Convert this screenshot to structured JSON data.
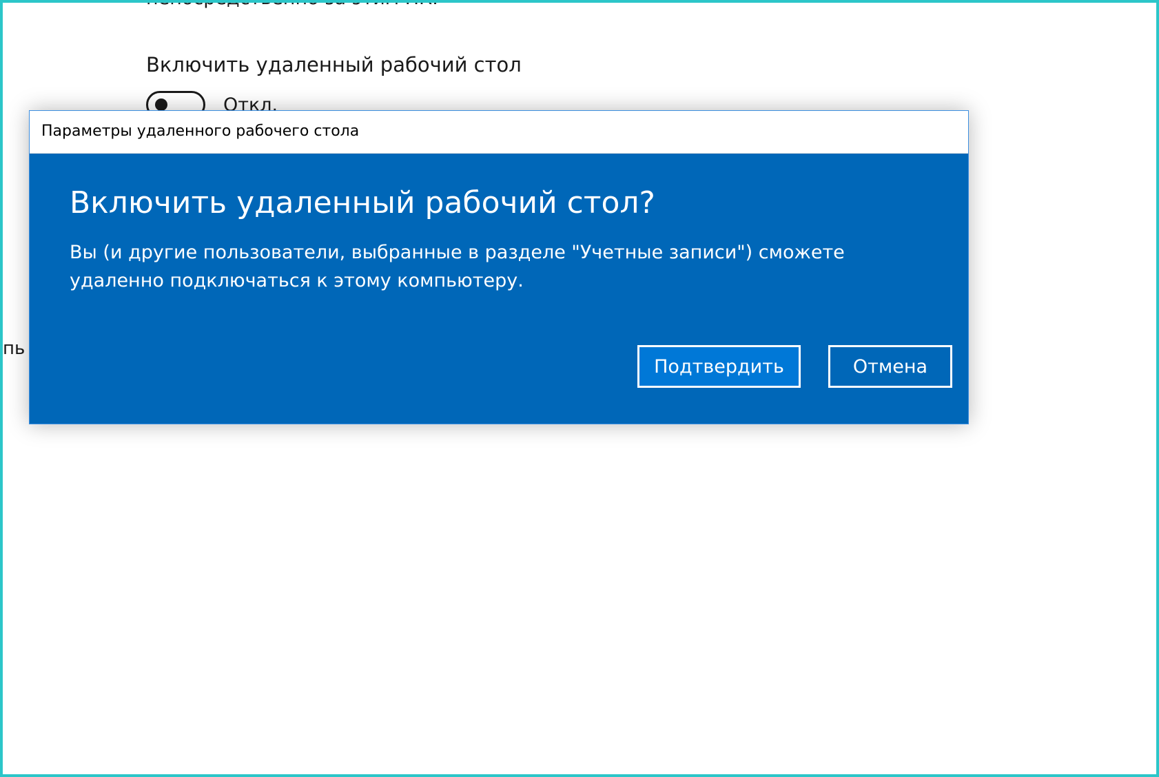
{
  "background": {
    "cut_text": "непосредственно за этим ПК.",
    "heading": "Включить удаленный рабочий стол",
    "toggle_state_label": "Откл.",
    "left_clipped_text": "пь"
  },
  "dialog": {
    "title": "Параметры удаленного рабочего стола",
    "heading": "Включить удаленный рабочий стол?",
    "body": "Вы (и другие пользователи, выбранные в разделе \"Учетные записи\") сможете удаленно подключаться к этому компьютеру.",
    "confirm_label": "Подтвердить",
    "cancel_label": "Отмена"
  },
  "colors": {
    "frame_border": "#2cc6c9",
    "dialog_background": "#0067b8",
    "confirm_button_background": "#0078d7"
  }
}
